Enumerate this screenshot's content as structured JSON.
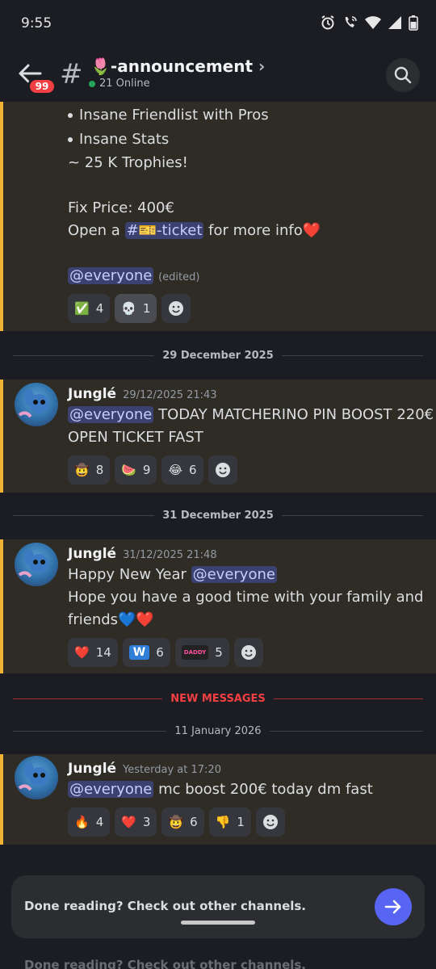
{
  "status": {
    "time": "9:55"
  },
  "header": {
    "badge": "99",
    "channel_emoji": "🌷",
    "channel_name": "-announcement",
    "online": "21 Online",
    "chevron": "›"
  },
  "msg0": {
    "bullets": [
      "Insane Friendlist with Pros",
      "Insane Stats"
    ],
    "trophies": "~ 25 K Trophies!",
    "fix_price": "Fix Price:  400€",
    "open_prefix": "Open a ",
    "ticket_mention": "#🎫-ticket",
    "open_suffix": " for more info❤️",
    "everyone": "@everyone",
    "edited": "(edited)",
    "reactions": [
      {
        "emoji": "✅",
        "count": "4"
      },
      {
        "emoji": "💀",
        "count": "1"
      }
    ]
  },
  "dividers": {
    "d1": "29 December 2025",
    "d2": "31 December 2025",
    "new": "NEW MESSAGES",
    "d3": "11 January 2026"
  },
  "msg1": {
    "author": "Junglé",
    "time": "29/12/2025 21:43",
    "mention": "@everyone",
    "text1": " TODAY MATCHERINO PIN BOOST 220€",
    "text2": "OPEN TICKET FAST",
    "reactions": [
      {
        "emoji": "🤠",
        "count": "8"
      },
      {
        "emoji": "🍉",
        "count": "9"
      },
      {
        "emoji": "😂",
        "count": "6"
      }
    ]
  },
  "msg2": {
    "author": "Junglé",
    "time": "31/12/2025 21:48",
    "line1": "Happy New Year ",
    "mention": "@everyone",
    "line2": "Hope you have a good time with your family and",
    "line3": "friends💙❤️",
    "reactions": [
      {
        "emoji": "❤️",
        "count": "14"
      },
      {
        "emoji": "W",
        "count": "6"
      },
      {
        "emoji": "DADDY",
        "count": "5"
      }
    ]
  },
  "msg3": {
    "author": "Junglé",
    "time": "Yesterday at 17:20",
    "mention": "@everyone",
    "text": " mc boost 200€ today dm fast",
    "reactions": [
      {
        "emoji": "🔥",
        "count": "4"
      },
      {
        "emoji": "❤️",
        "count": "3"
      },
      {
        "emoji": "🤠",
        "count": "6"
      },
      {
        "emoji": "👎",
        "count": "1"
      }
    ]
  },
  "footer": {
    "notice": "Done reading? Check out other channels.",
    "ghost": "Done reading? Check out other channels."
  }
}
